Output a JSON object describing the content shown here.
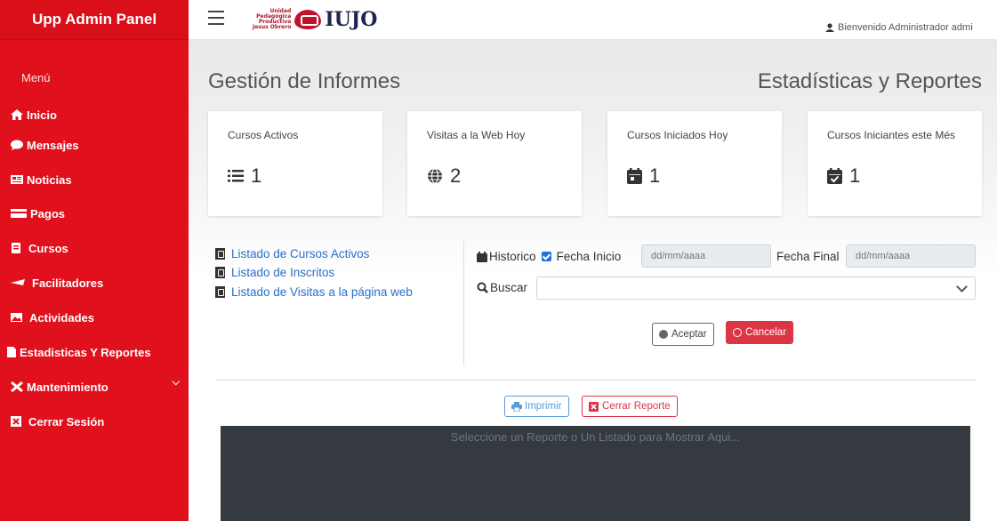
{
  "sidebar": {
    "brand": "Upp Admin Panel",
    "menu_heading": "Menú",
    "items": [
      {
        "label": "Inicio",
        "icon": "home-icon"
      },
      {
        "label": "Mensajes",
        "icon": "comment-icon"
      },
      {
        "label": "Noticias",
        "icon": "newspaper-icon"
      },
      {
        "label": "Pagos",
        "icon": "money-icon"
      },
      {
        "label": "Cursos",
        "icon": "book-icon"
      },
      {
        "label": "Facilitadores",
        "icon": "chalkboard-teacher-icon"
      },
      {
        "label": "Actividades",
        "icon": "image-icon"
      },
      {
        "label": "Estadisticas Y Reportes",
        "icon": "file-pdf-icon"
      },
      {
        "label": "Mantenimiento",
        "icon": "tools-icon"
      },
      {
        "label": "Cerrar Sesión",
        "icon": "close-box-icon"
      }
    ]
  },
  "header": {
    "logo_small": [
      "Unidad",
      "Pedagógica",
      "Productiva",
      "Jesus Obrero"
    ],
    "logo_text": "IUJO",
    "welcome": "Bienvenido Administrador admi"
  },
  "page": {
    "title": "Gestión de Informes",
    "subtitle": "Estadísticas y Reportes"
  },
  "stats": [
    {
      "label": "Cursos Activos",
      "value": "1",
      "icon": "list-icon"
    },
    {
      "label": "Visitas a la Web Hoy",
      "value": "2",
      "icon": "globe-icon"
    },
    {
      "label": "Cursos Iniciados Hoy",
      "value": "1",
      "icon": "calendar-icon"
    },
    {
      "label": "Cursos Iniciantes este Més",
      "value": "1",
      "icon": "calendar-check-icon"
    }
  ],
  "reports": [
    "Listado de Cursos Activos",
    "Listado de Inscritos",
    "Listado de Visitas a la página web"
  ],
  "filters": {
    "historico_label": "Historico",
    "fecha_inicio_label": "Fecha Inicio",
    "fecha_inicio_placeholder": "dd/mm/aaaa",
    "fecha_final_label": "Fecha Final",
    "fecha_final_placeholder": "dd/mm/aaaa",
    "buscar_label": "Buscar",
    "accept_label": "Aceptar",
    "cancel_label": "Cancelar"
  },
  "report_view": {
    "print_label": "Imprimir",
    "close_label": "Cerrar Reporte",
    "placeholder_message": "Seleccione un Reporte o Un Listado para Mostrar Aqui..."
  },
  "colors": {
    "sidebar": "#e0101c",
    "link": "#2a6fc9",
    "danger": "#dc3545",
    "panel": "#343a40"
  }
}
